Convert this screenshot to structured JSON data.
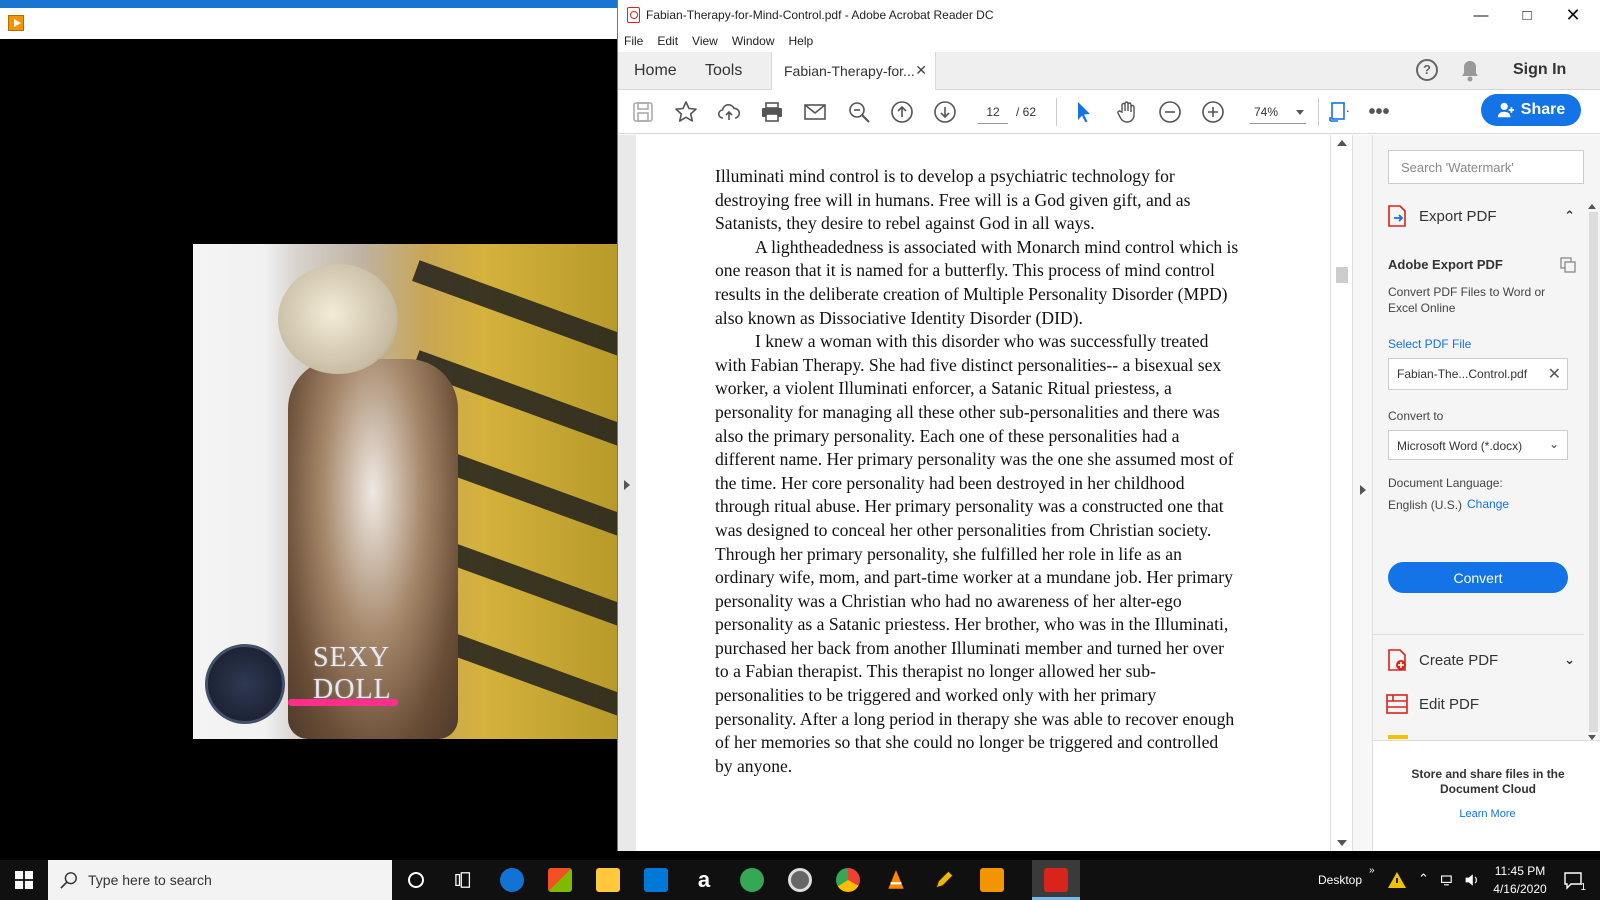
{
  "taskbar": {
    "search_placeholder": "Type here to search",
    "desktop_label": "Desktop",
    "time": "11:45 PM",
    "date": "4/16/2020",
    "notification_count": "1"
  },
  "video": {
    "watermark_line1": "SEXY",
    "watermark_line2": "DOLL"
  },
  "acrobat": {
    "window_title": "Fabian-Therapy-for-Mind-Control.pdf - Adobe Acrobat Reader DC",
    "menu": [
      "File",
      "Edit",
      "View",
      "Window",
      "Help"
    ],
    "tabs": {
      "home": "Home",
      "tools": "Tools",
      "document": "Fabian-Therapy-for..."
    },
    "sign_in": "Sign In",
    "toolbar": {
      "page_current": "12",
      "page_total": "/  62",
      "zoom": "74%",
      "share_label": "Share"
    },
    "document": {
      "paragraphs": [
        "Illuminati mind control is to develop a psychiatric technology for destroying free will in humans. Free will is a God given gift, and as Satanists, they desire to rebel against God in all ways.",
        "A lightheadedness is associated with Monarch mind control which is one reason that it is named for a butterfly. This process of mind control results in the deliberate creation of Multiple Personality Disorder (MPD) also known as Dissociative Identity Disorder (DID).",
        "I knew a woman with this disorder who was successfully treated with Fabian Therapy. She had five distinct personalities-- a bisexual sex worker, a violent Illuminati enforcer, a Satanic Ritual priestess, a personality for managing all these other sub-personalities and there was also the primary personality. Each one of these personalities had a different name. Her primary personality was the one she assumed most of the time. Her core personality had been destroyed in her childhood through ritual abuse. Her primary personality was a constructed one that was designed to conceal her other personalities from Christian society. Through her primary personality, she fulfilled her role in life as an ordinary wife, mom, and part-time worker at a mundane job. Her primary personality was a Christian who had no awareness of her alter-ego personality as a Satanic priestess. Her brother, who was in the Illuminati, purchased her back from another Illuminati member and turned her over to a Fabian therapist. This therapist no longer allowed her sub-personalities to be triggered and worked only with her primary personality. After a long period in therapy she was able to recover enough of her memories so that she could no longer be triggered and controlled by anyone."
      ]
    },
    "right_pane": {
      "search_placeholder": "Search 'Watermark'",
      "export_pdf": "Export PDF",
      "heading": "Adobe Export PDF",
      "description": "Convert PDF Files to Word or Excel Online",
      "select_file": "Select PDF File",
      "file_name": "Fabian-The...Control.pdf",
      "convert_to_label": "Convert to",
      "convert_to_value": "Microsoft Word (*.docx)",
      "doc_language_label": "Document Language:",
      "doc_language_value": "English (U.S.)",
      "change_link": "Change",
      "convert_button": "Convert",
      "create_pdf": "Create PDF",
      "edit_pdf": "Edit PDF",
      "cloud_title": "Store and share files in the Document Cloud",
      "learn_more": "Learn More"
    }
  },
  "colors": {
    "accent": "#1473e6",
    "pdf_red": "#d9241b",
    "taskbar": "#101010"
  }
}
